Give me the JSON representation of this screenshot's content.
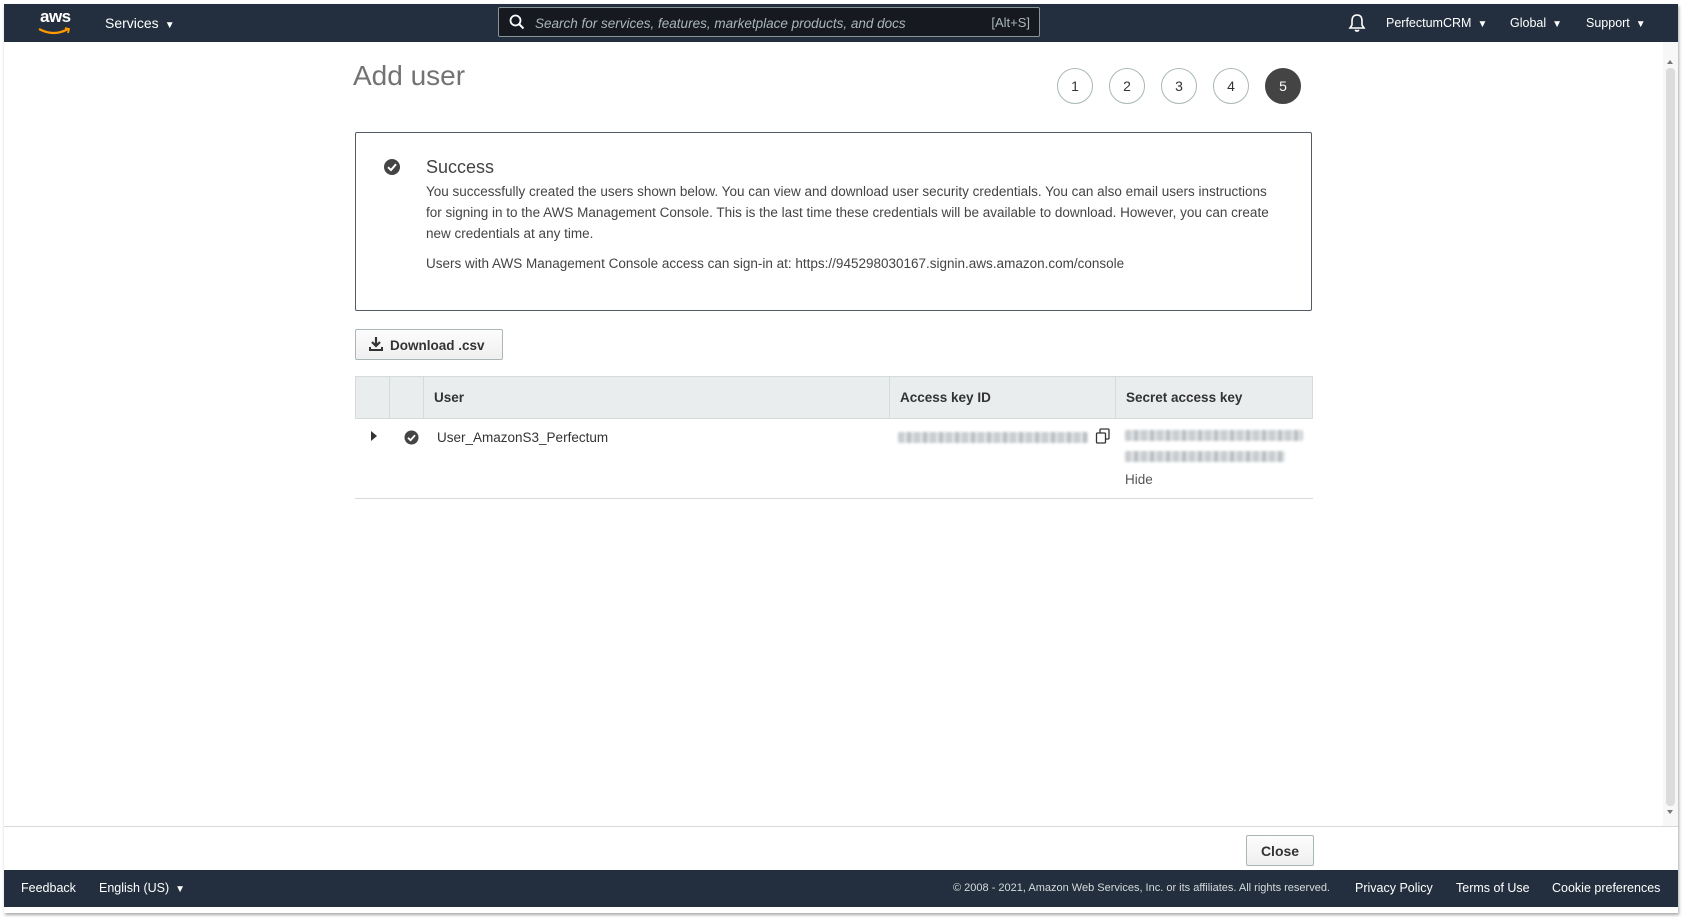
{
  "topnav": {
    "logo_text": "aws",
    "services_label": "Services",
    "search_placeholder": "Search for services, features, marketplace products, and docs",
    "search_shortcut": "[Alt+S]",
    "account_label": "PerfectumCRM",
    "region_label": "Global",
    "support_label": "Support",
    "icons": [
      "aws-logo",
      "search-icon",
      "bell-icon",
      "caret-down-icon"
    ]
  },
  "page": {
    "title": "Add user",
    "steps": [
      {
        "label": "1",
        "active": false
      },
      {
        "label": "2",
        "active": false
      },
      {
        "label": "3",
        "active": false
      },
      {
        "label": "4",
        "active": false
      },
      {
        "label": "5",
        "active": true
      }
    ]
  },
  "alert": {
    "title": "Success",
    "body": "You successfully created the users shown below. You can view and download user security credentials. You can also email users instructions for signing in to the AWS Management Console. This is the last time these credentials will be available to download. However, you can create new credentials at any time.",
    "signin_text": "Users with AWS Management Console access can sign-in at: https://945298030167.signin.aws.amazon.com/console",
    "icon": "check-circle-icon"
  },
  "download_button": {
    "label": "Download .csv",
    "icon": "download-icon"
  },
  "table": {
    "columns": [
      "",
      "",
      "User",
      "Access key ID",
      "Secret access key"
    ],
    "rows": [
      {
        "user": "User_AmazonS3_Perfectum",
        "access_key_id_visible": false,
        "secret_access_key_visible": false,
        "hide_label": "Hide"
      }
    ]
  },
  "actions": {
    "close_label": "Close"
  },
  "footer": {
    "feedback": "Feedback",
    "language": "English (US)",
    "copyright": "© 2008 - 2021, Amazon Web Services, Inc. or its affiliates. All rights reserved.",
    "privacy": "Privacy Policy",
    "terms": "Terms of Use",
    "cookie": "Cookie preferences"
  },
  "colors": {
    "nav_bg": "#232f3e",
    "active_step": "#444444",
    "text": "#333333"
  }
}
